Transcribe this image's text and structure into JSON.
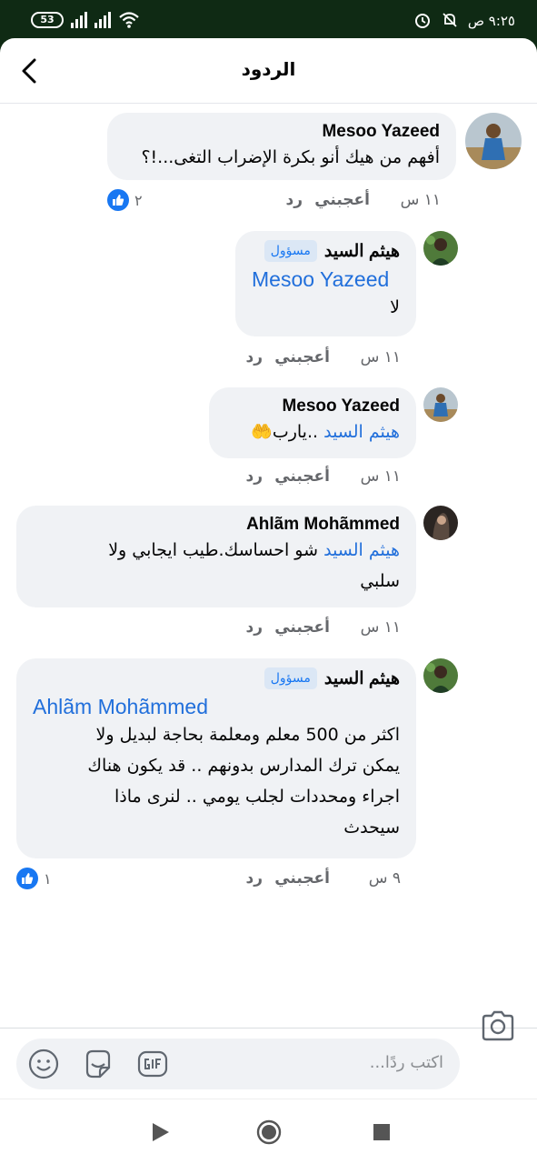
{
  "status_bar": {
    "time": "٩:٢٥ ص",
    "battery": "53"
  },
  "header": {
    "title": "الردود",
    "back_icon": "chevron-left-icon"
  },
  "comments": [
    {
      "author": "Mesoo Yazeed",
      "text": "أفهم من هيك أنو بكرة الإضراب التغى...!؟",
      "time": "١١ س",
      "like_label": "أعجبني",
      "reply_label": "رد",
      "reaction_count": "٢"
    },
    {
      "author": "هيثم السيد",
      "badge": "مسؤول",
      "mention": "Mesoo Yazeed",
      "text": "لا",
      "time": "١١ س",
      "like_label": "أعجبني",
      "reply_label": "رد"
    },
    {
      "author": "Mesoo Yazeed",
      "mention": "هيثم السيد",
      "text": "..يارب🤲",
      "time": "١١ س",
      "like_label": "أعجبني",
      "reply_label": "رد"
    },
    {
      "author": "Ahlãm Mohãmmed",
      "mention": "هيثم السيد",
      "text_line1": "شو احساسك.طيب ايجابي ولا",
      "text_line2": "سلبي",
      "time": "١١ س",
      "like_label": "أعجبني",
      "reply_label": "رد"
    },
    {
      "author": "هيثم السيد",
      "badge": "مسؤول",
      "mention": "Ahlãm Mohãmmed",
      "lines": [
        "اكثر من 500 معلم ومعلمة بحاجة لبديل ولا",
        "يمكن ترك المدارس بدونهم .. قد يكون هناك",
        "اجراء ومحددات لجلب يومي .. لنرى ماذا",
        "سيحدث"
      ],
      "time": "٩ س",
      "like_label": "أعجبني",
      "reply_label": "رد",
      "reaction_count": "١"
    }
  ],
  "composer": {
    "placeholder": "اكتب ردًا..."
  },
  "colors": {
    "status_bar": "#0f2a14",
    "bubble": "#f0f2f5",
    "link": "#216fdb",
    "like_blue": "#1877f2"
  }
}
